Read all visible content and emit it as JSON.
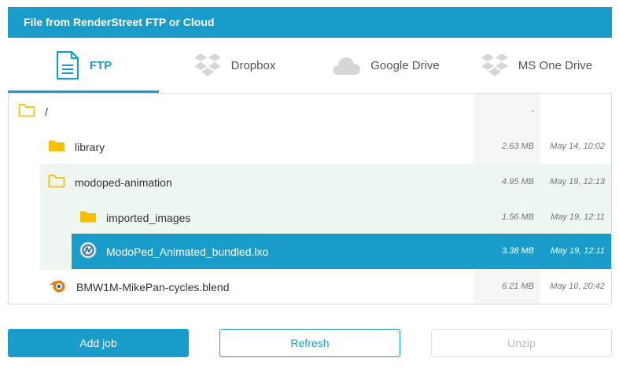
{
  "header": {
    "title": "File from RenderStreet FTP or Cloud"
  },
  "tabs": [
    {
      "label": "FTP",
      "icon": "document-icon",
      "active": true
    },
    {
      "label": "Dropbox",
      "icon": "dropbox-icon",
      "active": false
    },
    {
      "label": "Google Drive",
      "icon": "cloud-icon",
      "active": false
    },
    {
      "label": "MS One Drive",
      "icon": "dropbox-icon",
      "active": false
    }
  ],
  "files": [
    {
      "name": "/",
      "size": "-",
      "date": "",
      "icon": "folder-outline-icon"
    },
    {
      "name": "library",
      "size": "2.63 MB",
      "date": "May 14, 10:02",
      "icon": "folder-icon"
    },
    {
      "name": "modoped-animation",
      "size": "4.95 MB",
      "date": "May 19, 12:13",
      "icon": "folder-outline-icon"
    },
    {
      "name": "imported_images",
      "size": "1.56 MB",
      "date": "May 19, 12:11",
      "icon": "folder-icon"
    },
    {
      "name": "ModoPed_Animated_bundled.lxo",
      "size": "3.38 MB",
      "date": "May 19, 12:11",
      "icon": "modo-file-icon",
      "selected": true
    },
    {
      "name": "BMW1M-MikePan-cycles.blend",
      "size": "6.21 MB",
      "date": "May 10, 20:42",
      "icon": "blender-file-icon"
    }
  ],
  "buttons": {
    "add_job": "Add job",
    "refresh": "Refresh",
    "unzip": "Unzip"
  },
  "colors": {
    "accent": "#1a9ccb",
    "folder": "#f5c000",
    "blender": "#e87d0d"
  }
}
